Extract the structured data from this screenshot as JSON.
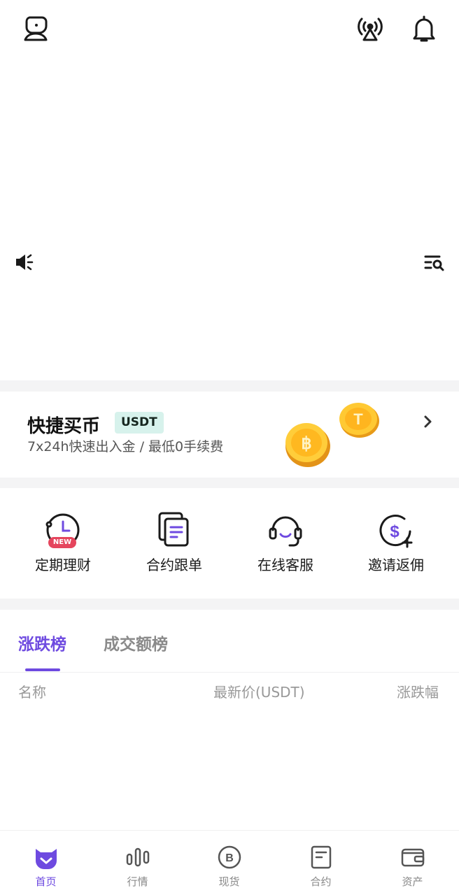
{
  "header": {
    "profile_icon": "user-robot-icon",
    "broadcast_icon": "broadcast-icon",
    "notification_icon": "bell-icon"
  },
  "announcement": {
    "speaker_icon": "speaker-icon",
    "list_search_icon": "list-search-icon"
  },
  "quick_buy": {
    "title": "快捷买币",
    "badge": "USDT",
    "subtitle": "7x24h快速出入金 / 最低0手续费"
  },
  "shortcuts": [
    {
      "label": "定期理财",
      "icon": "clock-icon",
      "badge": "NEW"
    },
    {
      "label": "合约跟单",
      "icon": "copy-document-icon"
    },
    {
      "label": "在线客服",
      "icon": "headset-icon"
    },
    {
      "label": "邀请返佣",
      "icon": "dollar-plus-icon"
    }
  ],
  "ranking": {
    "tabs": [
      {
        "label": "涨跌榜",
        "active": true
      },
      {
        "label": "成交额榜",
        "active": false
      }
    ],
    "columns": {
      "name": "名称",
      "price": "最新价(USDT)",
      "change": "涨跌幅"
    }
  },
  "bottom_nav": [
    {
      "label": "首页",
      "icon": "home-logo-icon",
      "active": true
    },
    {
      "label": "行情",
      "icon": "market-bars-icon",
      "active": false
    },
    {
      "label": "现货",
      "icon": "bitcoin-icon",
      "active": false
    },
    {
      "label": "合约",
      "icon": "contract-icon",
      "active": false
    },
    {
      "label": "资产",
      "icon": "wallet-icon",
      "active": false
    }
  ],
  "colors": {
    "accent": "#6e4ae0",
    "badge_bg": "#d7f2ec",
    "new_badge": "#e5455d",
    "section_gap": "#f4f4f5"
  }
}
